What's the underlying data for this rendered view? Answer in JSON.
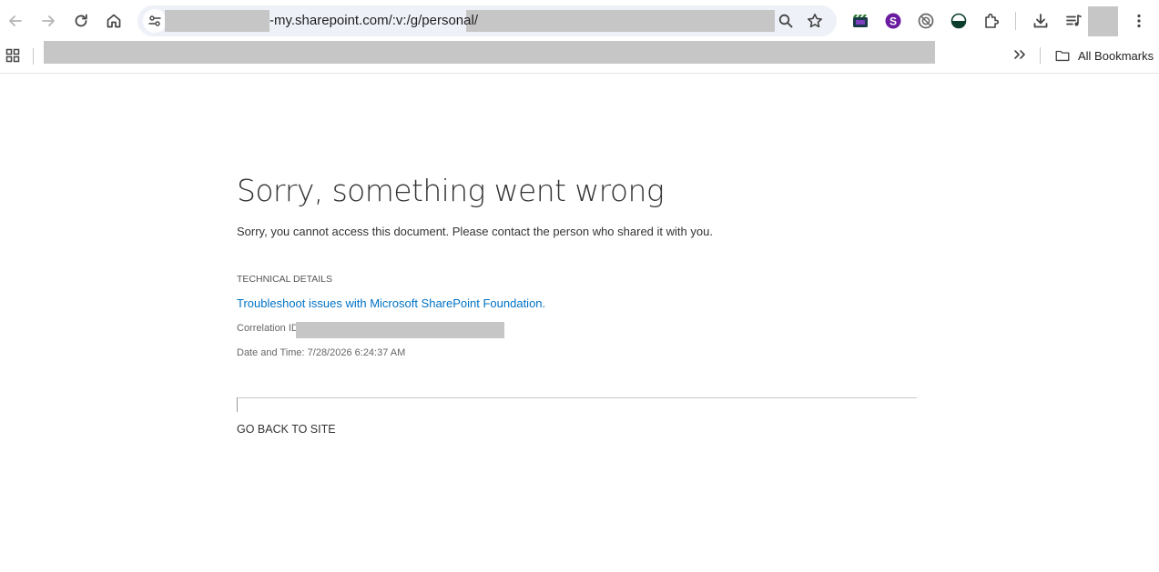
{
  "browser": {
    "url_visible": "-my.sharepoint.com/:v:/g/personal/",
    "bookmarks_all_label": "All Bookmarks",
    "icons": {
      "back": "arrow-left-icon",
      "forward": "arrow-right-icon",
      "reload": "reload-icon",
      "home": "home-icon",
      "site_info": "tune-icon",
      "zoom": "magnifier-icon",
      "bookmark_star": "star-icon",
      "extensions": [
        "clapperboard-icon",
        "s-circle-icon",
        "no-entry-circle-icon",
        "half-circle-icon",
        "puzzle-icon"
      ],
      "download": "download-icon",
      "reading_list": "playlist-icon",
      "menu": "kebab-menu-icon",
      "apps": "apps-grid-icon",
      "overflow": "double-chevron-icon",
      "folder": "folder-icon"
    },
    "colors": {
      "omnibox_bg": "#eef1f8",
      "redaction": "#c6c6c6",
      "s_extension": "#6b1ca0"
    }
  },
  "page": {
    "title": "Sorry, something went wrong",
    "message": "Sorry, you cannot access this document. Please contact the person who shared it with you.",
    "technical_details_heading": "TECHNICAL DETAILS",
    "troubleshoot_link": "Troubleshoot issues with Microsoft SharePoint Foundation.",
    "correlation_label": "Correlation ID",
    "date_time": "Date and Time: 7/28/2026 6:24:37 AM",
    "go_back": "GO BACK TO SITE",
    "colors": {
      "link": "#0072c6",
      "text": "#333333"
    }
  }
}
